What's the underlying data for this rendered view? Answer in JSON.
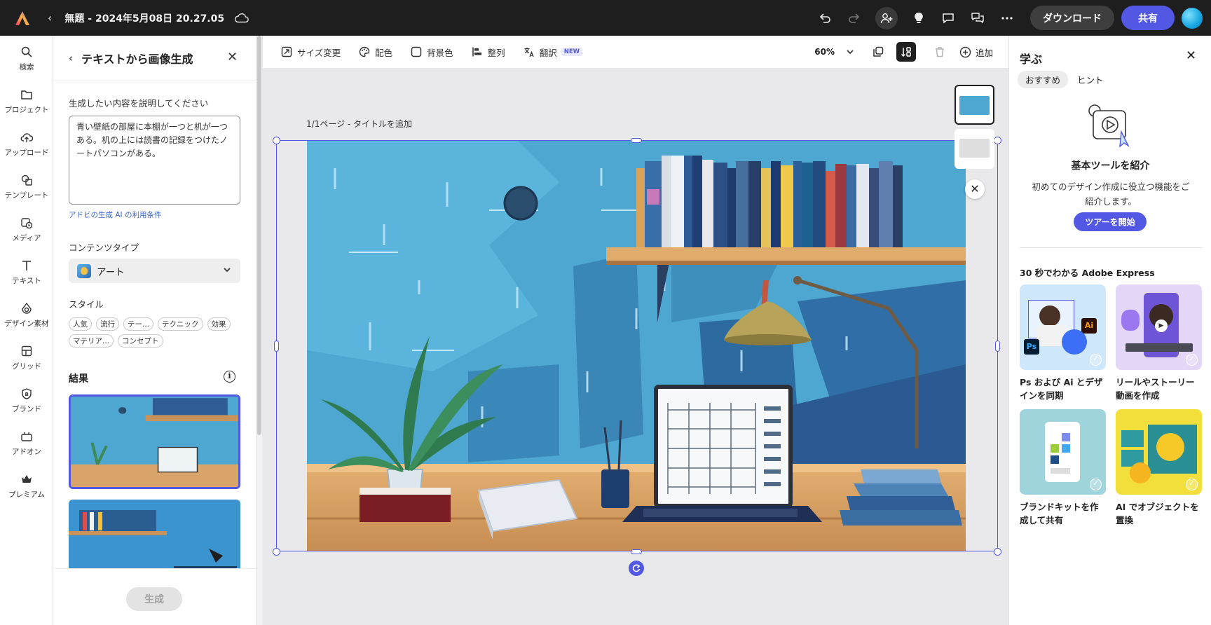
{
  "topbar": {
    "document_title": "無題 - 2024年5月08日 20.27.05",
    "download_label": "ダウンロード",
    "share_label": "共有"
  },
  "rail": [
    {
      "label": "検索",
      "icon": "search-icon"
    },
    {
      "label": "プロジェクト",
      "icon": "folder-icon"
    },
    {
      "label": "アップロード",
      "icon": "upload-icon"
    },
    {
      "label": "テンプレート",
      "icon": "template-icon"
    },
    {
      "label": "メディア",
      "icon": "media-icon"
    },
    {
      "label": "テキスト",
      "icon": "text-icon"
    },
    {
      "label": "デザイン素材",
      "icon": "elements-icon"
    },
    {
      "label": "グリッド",
      "icon": "grid-icon"
    },
    {
      "label": "ブランド",
      "icon": "brand-icon"
    },
    {
      "label": "アドオン",
      "icon": "addon-icon"
    },
    {
      "label": "プレミアム",
      "icon": "crown-icon"
    }
  ],
  "generate_panel": {
    "title": "テキストから画像生成",
    "prompt_label": "生成したい内容を説明してください",
    "prompt_value": "青い壁紙の部屋に本棚が一つと机が一つある。机の上には読書の記録をつけたノートパソコンがある。",
    "terms_link": "アドビの生成 AI の利用条件",
    "content_type_label": "コンテンツタイプ",
    "content_type_value": "アート",
    "style_label": "スタイル",
    "style_chips_row1": [
      "人気",
      "流行",
      "テー...",
      "テクニック",
      "効果"
    ],
    "style_chips_row2": [
      "マテリア...",
      "コンセプト"
    ],
    "results_label": "結果",
    "generate_button": "生成"
  },
  "toolbar": {
    "resize": "サイズ変更",
    "color": "配色",
    "background": "背景色",
    "align": "整列",
    "translate": "翻訳",
    "new_badge": "NEW",
    "zoom": "60%",
    "add": "追加"
  },
  "canvas": {
    "page_label": "1/1ページ - タイトルを追加"
  },
  "learn_panel": {
    "title": "学ぶ",
    "tabs": [
      "おすすめ",
      "ヒント"
    ],
    "intro_title": "基本ツールを紹介",
    "intro_text": "初めてのデザイン作成に役立つ機能をご紹介します。",
    "tour_button": "ツアーを開始",
    "section_title": "30 秒でわかる Adobe Express",
    "cards": [
      {
        "caption": "Ps および Ai とデザインを同期"
      },
      {
        "caption": "リールやストーリー動画を作成"
      },
      {
        "caption": "ブランドキットを作成して共有"
      },
      {
        "caption": "AI でオブジェクトを置換"
      }
    ]
  },
  "colors": {
    "accent": "#5258e4",
    "topbar": "#1e1e1e",
    "wall_blue": "#4ea7d1"
  }
}
